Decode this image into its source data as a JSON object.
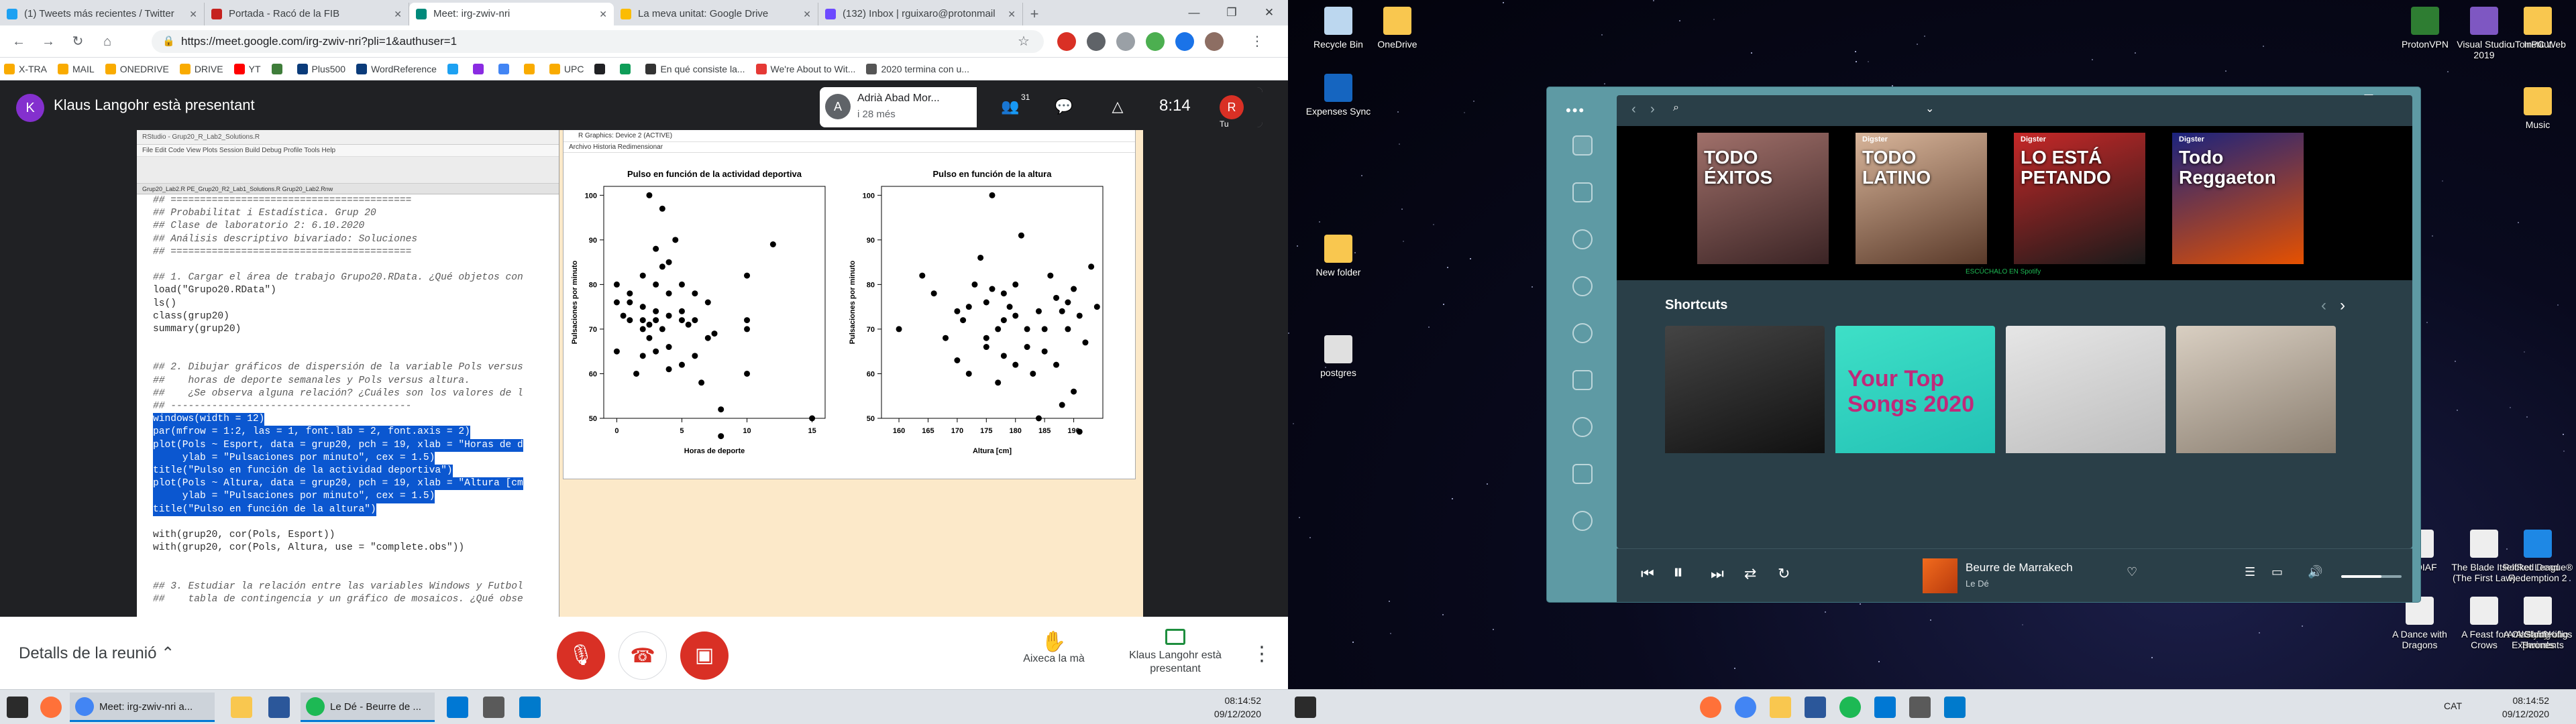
{
  "chrome": {
    "tabs": [
      {
        "label": "(1) Tweets más recientes / Twitter",
        "color": "#1da1f2"
      },
      {
        "label": "Portada - Racó de la FIB",
        "color": "#c5221f"
      },
      {
        "label": "Meet: irg-zwiv-nri",
        "color": "#00897b",
        "active": true
      },
      {
        "label": "La meva unitat: Google Drive",
        "color": "#fbbc04"
      },
      {
        "label": "(132) Inbox | rguixaro@protonmail",
        "color": "#6d4aff"
      }
    ],
    "new_tab": "+",
    "url": "https://meet.google.com/irg-zwiv-nri?pli=1&authuser=1",
    "bookmarks": [
      {
        "label": "X-TRA",
        "color": "#f9ab00"
      },
      {
        "label": "MAIL",
        "color": "#f9ab00"
      },
      {
        "label": "ONEDRIVE",
        "color": "#f9ab00"
      },
      {
        "label": "DRIVE",
        "color": "#f9ab00"
      },
      {
        "label": "YT",
        "color": "#ff0000"
      },
      {
        "label": "",
        "color": "#3f7d3a"
      },
      {
        "label": "Plus500",
        "color": "#0a3b7a"
      },
      {
        "label": "WordReference",
        "color": "#0a3b7a"
      },
      {
        "label": "",
        "color": "#1da1f2"
      },
      {
        "label": "",
        "color": "#8a2be2"
      },
      {
        "label": "",
        "color": "#4285f4"
      },
      {
        "label": "",
        "color": "#f9ab00"
      },
      {
        "label": "UPC",
        "color": "#f9ab00"
      },
      {
        "label": "",
        "color": "#202124"
      },
      {
        "label": "",
        "color": "#0f9d58"
      },
      {
        "label": "En qué consiste la...",
        "color": "#333"
      },
      {
        "label": "We're About to Wit...",
        "color": "#e53935"
      },
      {
        "label": "2020 termina con u...",
        "color": "#555"
      }
    ]
  },
  "meet": {
    "presenter_initial": "K",
    "presenter_title": "Klaus Langohr està presentant",
    "participant_initial": "A",
    "participant_name": "Adrià Abad Mor...",
    "participant_sub": "i 28 més",
    "participants_count": "31",
    "time": "8:14",
    "me_initial": "R",
    "me_label": "Tu",
    "details_label": "Detalls de la reunió",
    "raise_hand_label": "Aixeca la mà",
    "presenting_label": "Klaus Langohr està presentant"
  },
  "rstudio": {
    "title": "RStudio - Grup20_R_Lab2_Solutions.R",
    "menu": "File  Edit  Code  View  Plots  Session  Build  Debug  Profile  Tools  Help",
    "tabs": "Grup20_Lab2.R   PE_Grup20_R2_Lab1_Solutions.R   Grup20_Lab2.Rnw",
    "code_lines": [
      {
        "t": "## =========================================",
        "c": "cm"
      },
      {
        "t": "## Probabilitat i Estadística. Grup 20",
        "c": "cm"
      },
      {
        "t": "## Clase de laboratorio 2: 6.10.2020",
        "c": "cm"
      },
      {
        "t": "## Análisis descriptivo bivariado: Soluciones",
        "c": "cm"
      },
      {
        "t": "## =========================================",
        "c": "cm"
      },
      {
        "t": "",
        "c": ""
      },
      {
        "t": "## 1. Cargar el área de trabajo Grupo20.RData. ¿Qué objetos con",
        "c": "cm"
      },
      {
        "t": "load(\"Grupo20.RData\")",
        "c": ""
      },
      {
        "t": "ls()",
        "c": ""
      },
      {
        "t": "class(grup20)",
        "c": ""
      },
      {
        "t": "summary(grup20)",
        "c": ""
      },
      {
        "t": "",
        "c": ""
      },
      {
        "t": "",
        "c": ""
      },
      {
        "t": "## 2. Dibujar gráficos de dispersión de la variable Pols versus",
        "c": "cm"
      },
      {
        "t": "##    horas de deporte semanales y Pols versus altura.",
        "c": "cm"
      },
      {
        "t": "##    ¿Se observa alguna relación? ¿Cuáles son los valores de l",
        "c": "cm"
      },
      {
        "t": "## -----------------------------------------",
        "c": "cm"
      },
      {
        "t": "windows(width = 12)",
        "c": "hl"
      },
      {
        "t": "par(mfrow = 1:2, las = 1, font.lab = 2, font.axis = 2)",
        "c": "hl"
      },
      {
        "t": "plot(Pols ~ Esport, data = grup20, pch = 19, xlab = \"Horas de d",
        "c": "hl"
      },
      {
        "t": "     ylab = \"Pulsaciones por minuto\", cex = 1.5)",
        "c": "hl"
      },
      {
        "t": "title(\"Pulso en función de la actividad deportiva\")",
        "c": "hl"
      },
      {
        "t": "plot(Pols ~ Altura, data = grup20, pch = 19, xlab = \"Altura [cm",
        "c": "hl"
      },
      {
        "t": "     ylab = \"Pulsaciones por minuto\", cex = 1.5)",
        "c": "hl"
      },
      {
        "t": "title(\"Pulso en función de la altura\")",
        "c": "hl"
      },
      {
        "t": "",
        "c": ""
      },
      {
        "t": "with(grup20, cor(Pols, Esport))",
        "c": ""
      },
      {
        "t": "with(grup20, cor(Pols, Altura, use = \"complete.obs\"))",
        "c": ""
      },
      {
        "t": "",
        "c": ""
      },
      {
        "t": "",
        "c": ""
      },
      {
        "t": "## 3. Estudiar la relación entre las variables Windows y Futbol",
        "c": "cm"
      },
      {
        "t": "##    tabla de contingencia y un gráfico de mosaicos. ¿Qué obse",
        "c": "cm"
      }
    ]
  },
  "rplot": {
    "title": "R Graphics: Device 2 (ACTIVE)",
    "menu": "Archivo   Historia   Redimensionar"
  },
  "chart_data": [
    {
      "type": "scatter",
      "title": "Pulso en función de la actividad deportiva",
      "xlabel": "Horas de deporte",
      "ylabel": "Pulsaciones por minuto",
      "xlim": [
        -1,
        16
      ],
      "ylim": [
        50,
        102
      ],
      "xticks": [
        0,
        5,
        10,
        15
      ],
      "yticks": [
        50,
        60,
        70,
        80,
        90,
        100
      ],
      "x": [
        0,
        0,
        0,
        0.5,
        1,
        1,
        1,
        1.5,
        2,
        2,
        2,
        2,
        2,
        2.5,
        2.5,
        2.5,
        3,
        3,
        3,
        3,
        3,
        3.5,
        3.5,
        3.5,
        4,
        4,
        4,
        4,
        4,
        4.5,
        5,
        5,
        5,
        5,
        5.5,
        6,
        6,
        6,
        6.5,
        7,
        7,
        7.5,
        8,
        8,
        10,
        10,
        10,
        10,
        12,
        15
      ],
      "y": [
        65,
        76,
        80,
        73,
        72,
        76,
        78,
        60,
        64,
        70,
        72,
        75,
        82,
        68,
        71,
        100,
        74,
        72,
        80,
        88,
        65,
        70,
        84,
        97,
        61,
        66,
        73,
        78,
        85,
        90,
        72,
        74,
        62,
        80,
        71,
        72,
        64,
        78,
        58,
        68,
        76,
        69,
        52,
        46,
        60,
        70,
        72,
        82,
        89,
        50
      ]
    },
    {
      "type": "scatter",
      "title": "Pulso en función de la altura",
      "xlabel": "Altura [cm]",
      "ylabel": "Pulsaciones por minuto",
      "xlim": [
        157,
        195
      ],
      "ylim": [
        50,
        102
      ],
      "xticks": [
        160,
        165,
        170,
        175,
        180,
        185,
        190
      ],
      "yticks": [
        50,
        60,
        70,
        80,
        90,
        100
      ],
      "x": [
        160,
        164,
        166,
        168,
        170,
        170,
        171,
        172,
        172,
        173,
        174,
        175,
        175,
        175,
        176,
        176,
        177,
        177,
        178,
        178,
        178,
        179,
        180,
        180,
        180,
        181,
        182,
        182,
        183,
        184,
        184,
        185,
        185,
        186,
        187,
        187,
        188,
        188,
        189,
        189,
        190,
        190,
        191,
        191,
        192,
        193,
        194
      ],
      "y": [
        70,
        82,
        78,
        68,
        63,
        74,
        72,
        60,
        75,
        80,
        86,
        66,
        76,
        68,
        79,
        100,
        70,
        58,
        72,
        78,
        64,
        75,
        80,
        62,
        73,
        91,
        70,
        66,
        60,
        74,
        50,
        70,
        65,
        82,
        62,
        77,
        53,
        74,
        76,
        70,
        56,
        79,
        47,
        73,
        67,
        84,
        75
      ]
    }
  ],
  "desktop": {
    "icons": [
      {
        "label": "Recycle Bin",
        "color": "#bcd7ef"
      },
      {
        "label": "OneDrive",
        "color": "#f9c74f"
      },
      {
        "label": "Expenses Sync",
        "color": "#1565c0"
      },
      {
        "label": "New folder",
        "color": "#f9c74f"
      },
      {
        "label": "postgres",
        "color": "#e0e0e0"
      },
      {
        "label": "ProtonVPN",
        "color": "#2e7d32"
      },
      {
        "label": "Visual Studio 2019",
        "color": "#7e57c2"
      },
      {
        "label": "uTorrent Web",
        "color": "#43a047"
      },
      {
        "label": "Institut",
        "color": "#f9c74f"
      },
      {
        "label": "PC",
        "color": "#f9c74f"
      },
      {
        "label": "Music",
        "color": "#f9c74f"
      },
      {
        "label": "Red Dead Redemption 2",
        "color": "#b71c1c"
      },
      {
        "label": "Rocket League®",
        "color": "#1e88e5"
      },
      {
        "label": "Unity",
        "color": "#212121"
      },
      {
        "label": "Android Studio",
        "color": "#43a047"
      },
      {
        "label": "Trying Experiments",
        "color": "#f9c74f"
      },
      {
        "label": "ASOIAF",
        "color": "#eeeeee"
      },
      {
        "label": "The Blade Itself (The First Law)",
        "color": "#eeeeee"
      },
      {
        "label": "A Dance with Dragons",
        "color": "#eeeeee"
      },
      {
        "label": "A Feast for Crows",
        "color": "#eeeeee"
      },
      {
        "label": "A Storm of Swords",
        "color": "#eeeeee"
      },
      {
        "label": "A Clash of Kings",
        "color": "#eeeeee"
      },
      {
        "label": "A Game of Thrones",
        "color": "#eeeeee"
      }
    ]
  },
  "spotify": {
    "banner": [
      {
        "brand": "",
        "label": "TODO\nÉXITOS",
        "c1": "#a0706a",
        "c2": "#3b2425"
      },
      {
        "brand": "Digster",
        "label": "TODO LATINO",
        "c1": "#d8b59a",
        "c2": "#5a3a2a"
      },
      {
        "brand": "Digster",
        "label": "LO ESTÁ\nPETANDO",
        "c1": "#c62828",
        "c2": "#1a1a1a"
      },
      {
        "brand": "Digster",
        "label": "Todo\nReggaeton",
        "c1": "#1a237e",
        "c2": "#e65100"
      }
    ],
    "banner_footer": "ESCÚCHALO EN  Spotify",
    "shortcuts_title": "Shortcuts",
    "cards": [
      {
        "label": "",
        "c1": "#444",
        "c2": "#111"
      },
      {
        "label": "Your Top Songs 2020",
        "c1": "#3ee0c7",
        "c2": "#23c1b5"
      },
      {
        "label": "",
        "c1": "#e6e6e6",
        "c2": "#bdbdbd"
      },
      {
        "label": "",
        "c1": "#d9cfc2",
        "c2": "#8a7e70"
      }
    ],
    "track": "Beurre de Marrakech",
    "artist": "Le Dé"
  },
  "taskbar_left": {
    "apps": [
      {
        "label": "Meet: irg-zwiv-nri a...",
        "color": "#4285f4"
      },
      {
        "label": "Le Dé - Beurre de ...",
        "color": "#1db954"
      }
    ],
    "time": "08:14:52",
    "date": "09/12/2020"
  },
  "taskbar_right": {
    "lang": "CAT",
    "time": "08:14:52",
    "date": "09/12/2020"
  }
}
